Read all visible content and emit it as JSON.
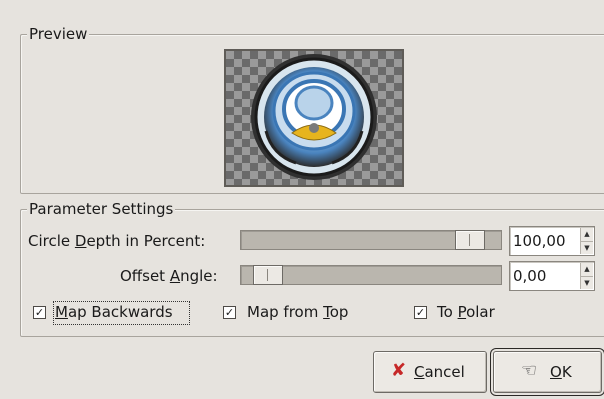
{
  "preview": {
    "title": "Preview"
  },
  "parameters": {
    "title": "Parameter Settings",
    "depth": {
      "label_pre": "Circle ",
      "label_mnemonic": "D",
      "label_post": "epth in Percent:",
      "value": "100,00",
      "level": 0.93
    },
    "angle": {
      "label_pre": "Offset ",
      "label_mnemonic": "A",
      "label_post": "ngle:",
      "value": "0,00",
      "level": 0.0
    },
    "map_backwards": {
      "label_mnemonic": "M",
      "label_post": "ap Backwards",
      "checked": true
    },
    "map_from_top": {
      "label_pre": "Map from ",
      "label_mnemonic": "T",
      "label_post": "op",
      "checked": true
    },
    "to_polar": {
      "label_pre": "To ",
      "label_mnemonic": "P",
      "label_post": "olar",
      "checked": true
    }
  },
  "buttons": {
    "cancel": {
      "mnemonic": "C",
      "post": "ancel",
      "icon": "x-cancel-icon",
      "icon_color": "#c62828"
    },
    "ok": {
      "mnemonic": "O",
      "post": "K",
      "icon": "ok-hand-icon"
    }
  },
  "colors": {
    "dialog_bg": "#e6e3de",
    "trough": "#bab6ae",
    "accent_yellow": "#e7b41e"
  }
}
